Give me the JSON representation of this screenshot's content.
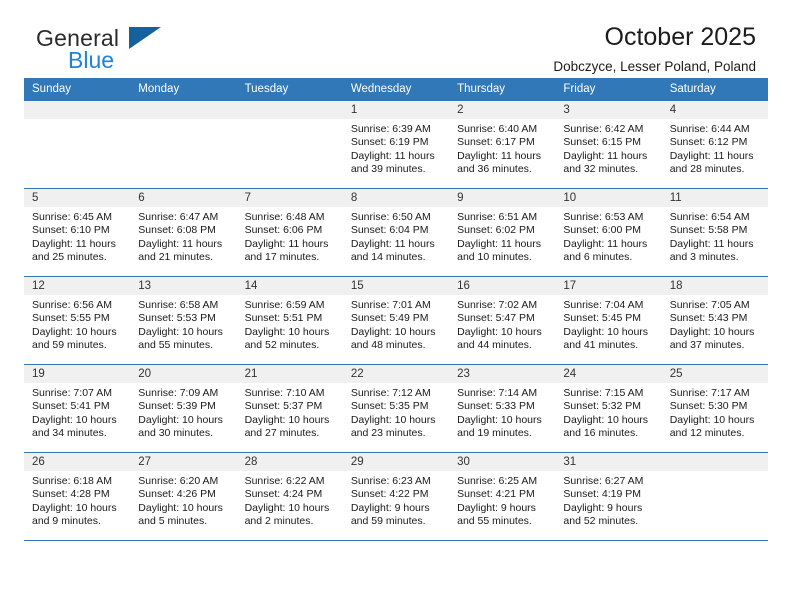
{
  "brand": {
    "name_part1": "General",
    "name_part2": "Blue",
    "triangle_color": "#15619e",
    "blue_text_color": "#1f83d6"
  },
  "header": {
    "title": "October 2025",
    "subtitle": "Dobczyce, Lesser Poland, Poland"
  },
  "theme": {
    "header_blue": "#3178b8",
    "daynum_bg": "#f0f0f0"
  },
  "weekday_headers": [
    "Sunday",
    "Monday",
    "Tuesday",
    "Wednesday",
    "Thursday",
    "Friday",
    "Saturday"
  ],
  "weeks": [
    [
      {
        "day": "",
        "sunrise": "",
        "sunset": "",
        "daylight": "",
        "empty": true
      },
      {
        "day": "",
        "sunrise": "",
        "sunset": "",
        "daylight": "",
        "empty": true
      },
      {
        "day": "",
        "sunrise": "",
        "sunset": "",
        "daylight": "",
        "empty": true
      },
      {
        "day": "1",
        "sunrise": "Sunrise: 6:39 AM",
        "sunset": "Sunset: 6:19 PM",
        "daylight": "Daylight: 11 hours and 39 minutes."
      },
      {
        "day": "2",
        "sunrise": "Sunrise: 6:40 AM",
        "sunset": "Sunset: 6:17 PM",
        "daylight": "Daylight: 11 hours and 36 minutes."
      },
      {
        "day": "3",
        "sunrise": "Sunrise: 6:42 AM",
        "sunset": "Sunset: 6:15 PM",
        "daylight": "Daylight: 11 hours and 32 minutes."
      },
      {
        "day": "4",
        "sunrise": "Sunrise: 6:44 AM",
        "sunset": "Sunset: 6:12 PM",
        "daylight": "Daylight: 11 hours and 28 minutes."
      }
    ],
    [
      {
        "day": "5",
        "sunrise": "Sunrise: 6:45 AM",
        "sunset": "Sunset: 6:10 PM",
        "daylight": "Daylight: 11 hours and 25 minutes."
      },
      {
        "day": "6",
        "sunrise": "Sunrise: 6:47 AM",
        "sunset": "Sunset: 6:08 PM",
        "daylight": "Daylight: 11 hours and 21 minutes."
      },
      {
        "day": "7",
        "sunrise": "Sunrise: 6:48 AM",
        "sunset": "Sunset: 6:06 PM",
        "daylight": "Daylight: 11 hours and 17 minutes."
      },
      {
        "day": "8",
        "sunrise": "Sunrise: 6:50 AM",
        "sunset": "Sunset: 6:04 PM",
        "daylight": "Daylight: 11 hours and 14 minutes."
      },
      {
        "day": "9",
        "sunrise": "Sunrise: 6:51 AM",
        "sunset": "Sunset: 6:02 PM",
        "daylight": "Daylight: 11 hours and 10 minutes."
      },
      {
        "day": "10",
        "sunrise": "Sunrise: 6:53 AM",
        "sunset": "Sunset: 6:00 PM",
        "daylight": "Daylight: 11 hours and 6 minutes."
      },
      {
        "day": "11",
        "sunrise": "Sunrise: 6:54 AM",
        "sunset": "Sunset: 5:58 PM",
        "daylight": "Daylight: 11 hours and 3 minutes."
      }
    ],
    [
      {
        "day": "12",
        "sunrise": "Sunrise: 6:56 AM",
        "sunset": "Sunset: 5:55 PM",
        "daylight": "Daylight: 10 hours and 59 minutes."
      },
      {
        "day": "13",
        "sunrise": "Sunrise: 6:58 AM",
        "sunset": "Sunset: 5:53 PM",
        "daylight": "Daylight: 10 hours and 55 minutes."
      },
      {
        "day": "14",
        "sunrise": "Sunrise: 6:59 AM",
        "sunset": "Sunset: 5:51 PM",
        "daylight": "Daylight: 10 hours and 52 minutes."
      },
      {
        "day": "15",
        "sunrise": "Sunrise: 7:01 AM",
        "sunset": "Sunset: 5:49 PM",
        "daylight": "Daylight: 10 hours and 48 minutes."
      },
      {
        "day": "16",
        "sunrise": "Sunrise: 7:02 AM",
        "sunset": "Sunset: 5:47 PM",
        "daylight": "Daylight: 10 hours and 44 minutes."
      },
      {
        "day": "17",
        "sunrise": "Sunrise: 7:04 AM",
        "sunset": "Sunset: 5:45 PM",
        "daylight": "Daylight: 10 hours and 41 minutes."
      },
      {
        "day": "18",
        "sunrise": "Sunrise: 7:05 AM",
        "sunset": "Sunset: 5:43 PM",
        "daylight": "Daylight: 10 hours and 37 minutes."
      }
    ],
    [
      {
        "day": "19",
        "sunrise": "Sunrise: 7:07 AM",
        "sunset": "Sunset: 5:41 PM",
        "daylight": "Daylight: 10 hours and 34 minutes."
      },
      {
        "day": "20",
        "sunrise": "Sunrise: 7:09 AM",
        "sunset": "Sunset: 5:39 PM",
        "daylight": "Daylight: 10 hours and 30 minutes."
      },
      {
        "day": "21",
        "sunrise": "Sunrise: 7:10 AM",
        "sunset": "Sunset: 5:37 PM",
        "daylight": "Daylight: 10 hours and 27 minutes."
      },
      {
        "day": "22",
        "sunrise": "Sunrise: 7:12 AM",
        "sunset": "Sunset: 5:35 PM",
        "daylight": "Daylight: 10 hours and 23 minutes."
      },
      {
        "day": "23",
        "sunrise": "Sunrise: 7:14 AM",
        "sunset": "Sunset: 5:33 PM",
        "daylight": "Daylight: 10 hours and 19 minutes."
      },
      {
        "day": "24",
        "sunrise": "Sunrise: 7:15 AM",
        "sunset": "Sunset: 5:32 PM",
        "daylight": "Daylight: 10 hours and 16 minutes."
      },
      {
        "day": "25",
        "sunrise": "Sunrise: 7:17 AM",
        "sunset": "Sunset: 5:30 PM",
        "daylight": "Daylight: 10 hours and 12 minutes."
      }
    ],
    [
      {
        "day": "26",
        "sunrise": "Sunrise: 6:18 AM",
        "sunset": "Sunset: 4:28 PM",
        "daylight": "Daylight: 10 hours and 9 minutes."
      },
      {
        "day": "27",
        "sunrise": "Sunrise: 6:20 AM",
        "sunset": "Sunset: 4:26 PM",
        "daylight": "Daylight: 10 hours and 5 minutes."
      },
      {
        "day": "28",
        "sunrise": "Sunrise: 6:22 AM",
        "sunset": "Sunset: 4:24 PM",
        "daylight": "Daylight: 10 hours and 2 minutes."
      },
      {
        "day": "29",
        "sunrise": "Sunrise: 6:23 AM",
        "sunset": "Sunset: 4:22 PM",
        "daylight": "Daylight: 9 hours and 59 minutes."
      },
      {
        "day": "30",
        "sunrise": "Sunrise: 6:25 AM",
        "sunset": "Sunset: 4:21 PM",
        "daylight": "Daylight: 9 hours and 55 minutes."
      },
      {
        "day": "31",
        "sunrise": "Sunrise: 6:27 AM",
        "sunset": "Sunset: 4:19 PM",
        "daylight": "Daylight: 9 hours and 52 minutes."
      },
      {
        "day": "",
        "sunrise": "",
        "sunset": "",
        "daylight": "",
        "empty": true
      }
    ]
  ]
}
